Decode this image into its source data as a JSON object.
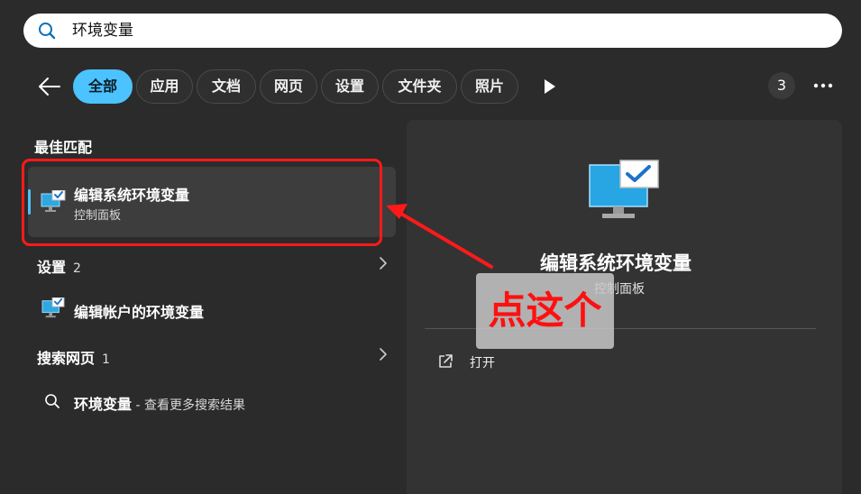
{
  "search": {
    "query": "环境变量"
  },
  "filters": {
    "tabs": [
      {
        "label": "全部",
        "active": true
      },
      {
        "label": "应用"
      },
      {
        "label": "文档"
      },
      {
        "label": "网页"
      },
      {
        "label": "设置"
      },
      {
        "label": "文件夹"
      },
      {
        "label": "照片"
      }
    ],
    "count_badge": "3"
  },
  "results": {
    "best_match_heading": "最佳匹配",
    "best_match": {
      "title": "编辑系统环境变量",
      "subtitle": "控制面板"
    },
    "settings_heading": "设置",
    "settings_count": "2",
    "settings_item": "编辑帐户的环境变量",
    "web_heading": "搜索网页",
    "web_count": "1",
    "web_query": "环境变量",
    "web_suffix": " - 查看更多搜索结果"
  },
  "preview": {
    "title": "编辑系统环境变量",
    "subtitle": "控制面板",
    "open_label": "打开"
  },
  "annotation": {
    "label": "点这个",
    "color": "#ff1a1a"
  },
  "icons": {
    "search": "search-icon",
    "back": "back-arrow-icon",
    "play": "play-icon",
    "more": "more-dots-icon",
    "app": "monitor-checkmark-icon",
    "open": "open-external-icon",
    "chevron": "chevron-right-icon"
  },
  "colors": {
    "accent": "#4cc2ff",
    "background": "#2b2b2b",
    "panel": "#333333",
    "annotation": "#ff1a1a"
  }
}
